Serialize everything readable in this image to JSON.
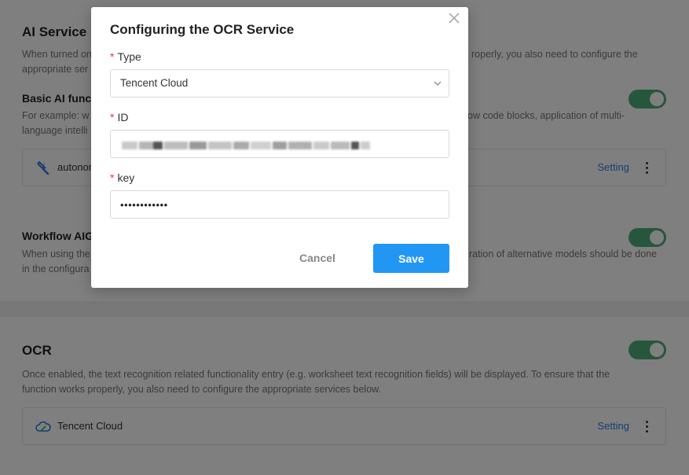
{
  "background": {
    "ai_service": {
      "title": "AI Service",
      "desc_line1_left": "When turned on",
      "desc_line1_right": "roperly, you also need to configure the",
      "desc_line2_left": "appropriate ser",
      "basic": {
        "title": "Basic AI func",
        "desc_line1_left": "For example: w",
        "desc_line1_right": "ow code blocks, application of multi-",
        "desc_line2_left": "language intelli"
      },
      "service_row": {
        "label": "autonor",
        "setting": "Setting"
      },
      "workflow": {
        "title": "Workflow AIG",
        "desc_line1_left": "When using the",
        "desc_line1_right": "ration of alternative models should be done",
        "desc_line2_left": "in the configura"
      }
    },
    "ocr": {
      "title": "OCR",
      "desc_line1": "Once enabled, the text recognition related functionality entry (e.g. worksheet text recognition fields) will be displayed. To ensure that the",
      "desc_line2": "function works properly, you also need to configure the appropriate services below.",
      "service_row": {
        "label": "Tencent Cloud",
        "setting": "Setting"
      }
    }
  },
  "dialog": {
    "title": "Configuring the OCR Service",
    "required_mark": "*",
    "type": {
      "label": "Type",
      "value": "Tencent Cloud"
    },
    "id": {
      "label": "ID"
    },
    "key": {
      "label": "key",
      "value": "••••••••••••"
    },
    "cancel_label": "Cancel",
    "save_label": "Save"
  },
  "colors": {
    "toggle_on": "#4caf7a",
    "primary": "#2196f3",
    "link": "#2b7de9",
    "required": "#e53935"
  },
  "icons": {
    "close": "close-icon",
    "chevron": "chevron-down-icon",
    "tool": "tools-icon",
    "cloud": "cloud-icon",
    "more": "more-vertical-icon"
  }
}
